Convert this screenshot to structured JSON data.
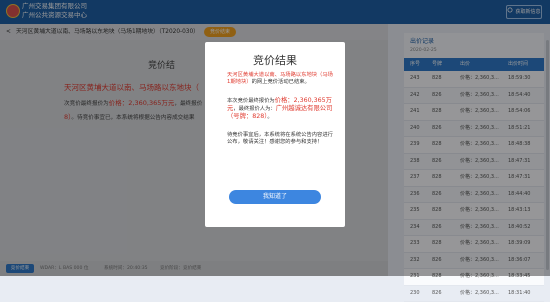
{
  "header": {
    "org_line1": "广州交易集团有限公司",
    "org_line2": "广州公共资源交易中心",
    "right_button": "获取新信息",
    "right_button_icon": "refresh-icon"
  },
  "titlebar": {
    "back_glyph": "<",
    "title": "天河区黄埔大道以南、马场路以东地块（马场1期地块）（T2020-030）",
    "badge": "竞价结束"
  },
  "background": {
    "heading": "竞价结",
    "line1_red": "天河区黄埔大道以南、马场路以东地块（",
    "line2_prefix": "次竞价最终报价为",
    "line2_price": "价格：2,360,365万元",
    "line2_suffix": "，最终报价",
    "line3_red": "8）",
    "line3_gray": "。待竞价事宜已，本系统将根据公告内容成交结果"
  },
  "footer": {
    "chip": "竞价结束",
    "info1": "WDAR：L BAS 000 位",
    "info2": "系统时间：20:40:35",
    "info3": "竞价阶段：竞价结束"
  },
  "records": {
    "title": "出价记录",
    "date": "2020-02-25",
    "columns": [
      "序号",
      "号牌",
      "出价",
      "出价时间"
    ],
    "rows": [
      [
        "243",
        "828",
        "价格：2,360,3...",
        "18:59:30"
      ],
      [
        "242",
        "826",
        "价格：2,360,3...",
        "18:54:40"
      ],
      [
        "241",
        "828",
        "价格：2,360,3...",
        "18:54:06"
      ],
      [
        "240",
        "826",
        "价格：2,360,3...",
        "18:51:21"
      ],
      [
        "239",
        "828",
        "价格：2,360,3...",
        "18:48:38"
      ],
      [
        "238",
        "826",
        "价格：2,360,3...",
        "18:47:31"
      ],
      [
        "237",
        "828",
        "价格：2,360,3...",
        "18:47:31"
      ],
      [
        "236",
        "826",
        "价格：2,360,3...",
        "18:44:40"
      ],
      [
        "235",
        "828",
        "价格：2,360,3...",
        "18:43:13"
      ],
      [
        "234",
        "826",
        "价格：2,360,3...",
        "18:40:52"
      ],
      [
        "233",
        "828",
        "价格：2,360,3...",
        "18:39:09"
      ],
      [
        "232",
        "826",
        "价格：2,360,3...",
        "18:36:07"
      ],
      [
        "231",
        "828",
        "价格：2,360,3...",
        "18:33:45"
      ],
      [
        "230",
        "826",
        "价格：2,360,3...",
        "18:31:40"
      ]
    ]
  },
  "modal": {
    "title": "竞价结果",
    "p1_red": "天河区黄埔大道以南、马场路以东地块（马场1期地块）",
    "p1_tail": "的网上竞价活动已结束。",
    "p2_prefix": "本次竞价最终报价为",
    "p2_price": "价格：2,360,365万元",
    "p2_suffix": "，最终报价人为：",
    "p2_winner": "广州越诚达有限公司（号牌：828）",
    "p2_tail": "。",
    "p3": "待竞价事宜后，本系统将在系统公告内容进行公布，敬请关注！感谢您的参与和支持！",
    "ok_button": "我知道了"
  }
}
